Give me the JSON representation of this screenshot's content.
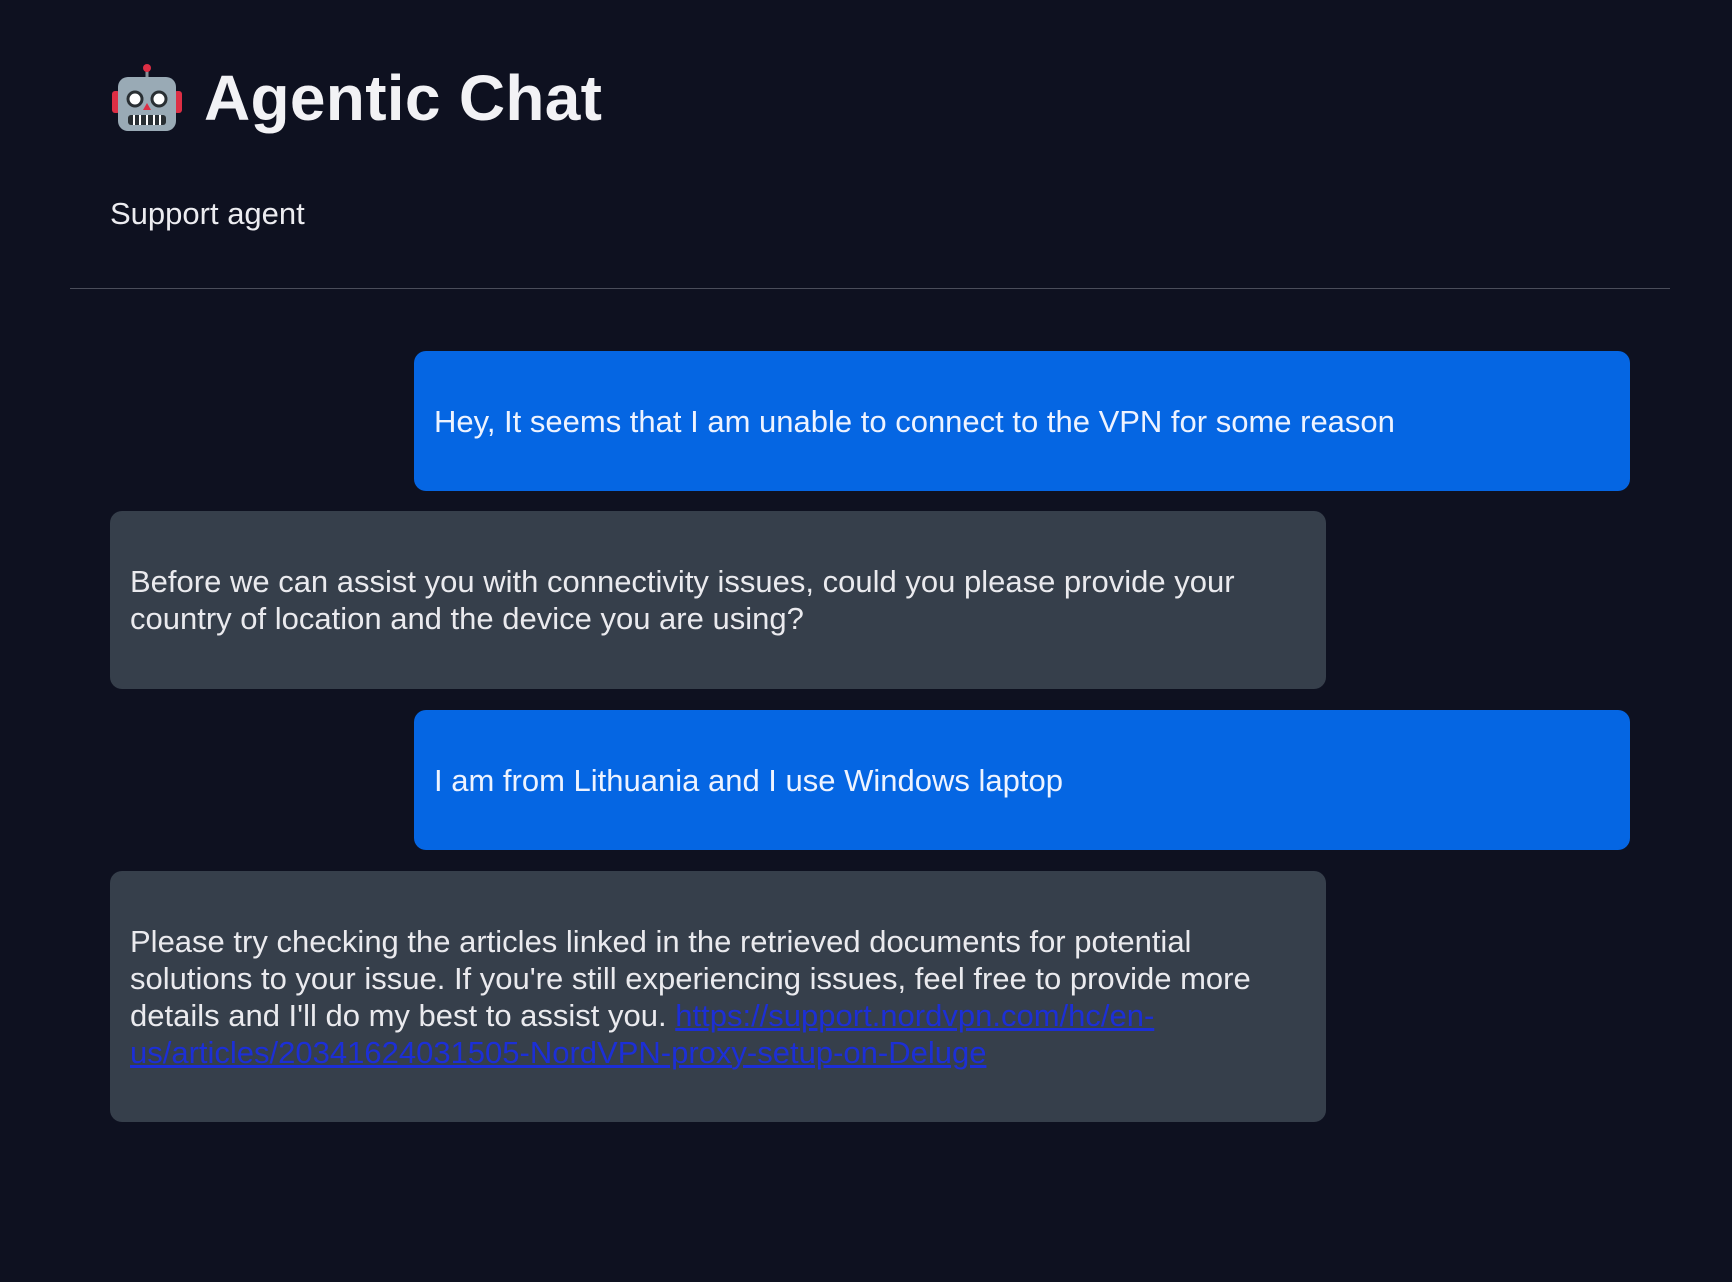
{
  "header": {
    "icon": "robot-icon",
    "title": "Agentic Chat",
    "subtitle": "Support agent"
  },
  "messages": [
    {
      "role": "user",
      "text": "Hey, It seems that I am unable to connect to the VPN for some reason"
    },
    {
      "role": "assistant",
      "text": "Before we can assist you with connectivity issues, could you please provide your country of location and the device you are using?"
    },
    {
      "role": "user",
      "text": "I am from Lithuania and I use Windows laptop"
    },
    {
      "role": "assistant",
      "text": "Please try checking the articles linked in the retrieved documents for potential solutions to your issue. If you're still experiencing issues, feel free to provide more details and I'll do my best to assist you. ",
      "link": "https://support.nordvpn.com/hc/en-us/articles/20341624031505-NordVPN-proxy-setup-on-Deluge"
    }
  ],
  "colors": {
    "background": "#0e1120",
    "user_bubble": "#0566e3",
    "assistant_bubble": "#363f4b",
    "link": "#1c2fd6"
  }
}
